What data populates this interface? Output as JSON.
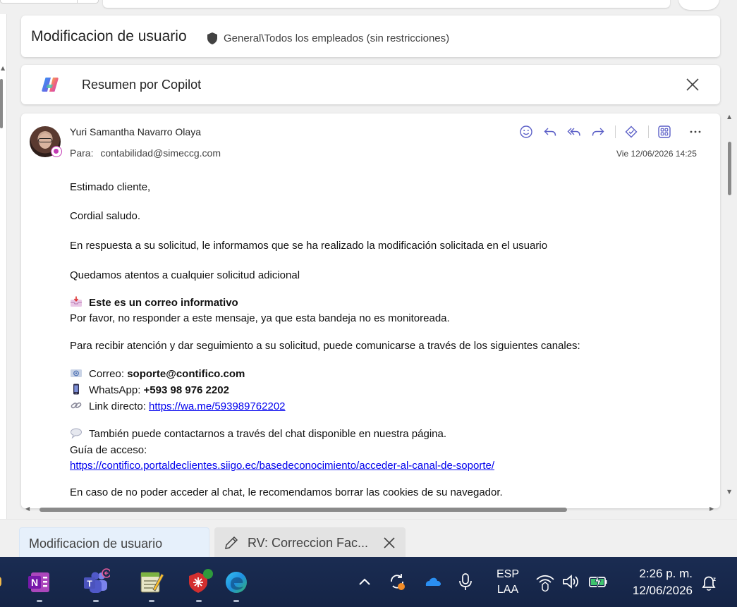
{
  "subject": {
    "title": "Modificacion de usuario",
    "sensitivity": "General\\Todos los empleados (sin restricciones)"
  },
  "copilot": {
    "label": "Resumen por Copilot"
  },
  "message": {
    "sender": "Yuri Samantha Navarro Olaya",
    "to_label": "Para:",
    "to": "contabilidad@simeccg.com",
    "date": "Vie 12/06/2026 14:25",
    "actions": [
      "emoji-react",
      "reply",
      "reply-all",
      "forward",
      "teams",
      "apps",
      "more"
    ]
  },
  "body": {
    "greeting": "Estimado cliente,",
    "salutation": "Cordial saludo.",
    "line1": "En respuesta a su solicitud, le informamos que se ha realizado la modificación solicitada en el usuario",
    "line2": "Quedamos atentos a cualquier solicitud adicional",
    "info_heading": "Este es un correo informativo",
    "info_text": "Por favor, no responder a este mensaje, ya que esta bandeja no es monitoreada.",
    "channels_intro": "Para recibir atención y dar seguimiento a su solicitud, puede comunicarse a través de los siguientes canales:",
    "email_label": "Correo:",
    "email_value": "soporte@contifico.com",
    "whatsapp_label": "WhatsApp:",
    "whatsapp_value": "+593 98 976 2202",
    "link_label": "Link directo:",
    "link_value": "https://wa.me/593989762202",
    "chat_text": "También puede contactarnos a través del chat disponible en nuestra página.",
    "guide_label": "Guía de acceso:",
    "guide_link": "https://contifico.portaldeclientes.siigo.ec/basedeconocimiento/acceder-al-canal-de-soporte/",
    "cookies_text": "En caso de no poder acceder al chat, le recomendamos borrar las cookies de su navegador."
  },
  "tabs": [
    {
      "label": "Modificacion de usuario",
      "active": true
    },
    {
      "label": "RV: Correccion Fac...",
      "active": false
    }
  ],
  "taskbar": {
    "apps": [
      "onenote-icon",
      "teams-icon",
      "notepad-icon",
      "vpn-icon",
      "edge-icon"
    ],
    "language_line1": "ESP",
    "language_line2": "LAA",
    "time": "2:26 p. m.",
    "date": "12/06/2026"
  },
  "colors": {
    "accent": "#5b5fc7",
    "link": "#0000ee",
    "taskbar": "#18284a"
  }
}
